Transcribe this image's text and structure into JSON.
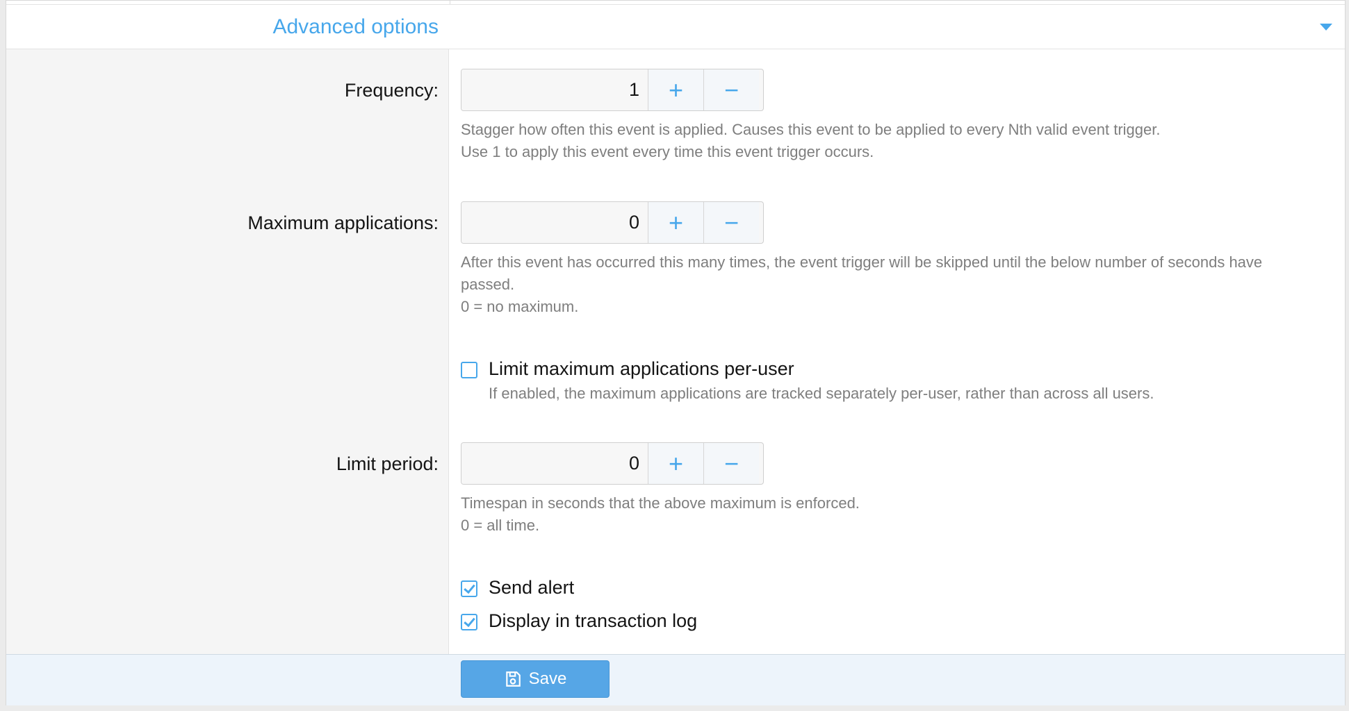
{
  "section": {
    "title": "Advanced options",
    "toggle_icon": "chevron-down-icon"
  },
  "frequency": {
    "label": "Frequency:",
    "value": "1",
    "help": [
      "Stagger how often this event is applied. Causes this event to be applied to every Nth valid event trigger.",
      "Use 1 to apply this event every time this event trigger occurs."
    ]
  },
  "max_applications": {
    "label": "Maximum applications:",
    "value": "0",
    "help": [
      "After this event has occurred this many times, the event trigger will be skipped until the below number of seconds have",
      "passed.",
      "0 = no maximum."
    ]
  },
  "per_user": {
    "label": "Limit maximum applications per-user",
    "checked": false,
    "help": "If enabled, the maximum applications are tracked separately per-user, rather than across all users."
  },
  "limit_period": {
    "label": "Limit period:",
    "value": "0",
    "help": [
      "Timespan in seconds that the above maximum is enforced.",
      "0 = all time."
    ]
  },
  "send_alert": {
    "label": "Send alert",
    "checked": true
  },
  "transaction_log": {
    "label": "Display in transaction log",
    "checked": true
  },
  "stepper": {
    "plus": "+",
    "minus": "−"
  },
  "footer": {
    "save_label": "Save"
  },
  "colors": {
    "accent": "#47a7eb",
    "save_button": "#56a6e6",
    "label_column": "#f5f5f5",
    "footer": "#edf4fb"
  }
}
